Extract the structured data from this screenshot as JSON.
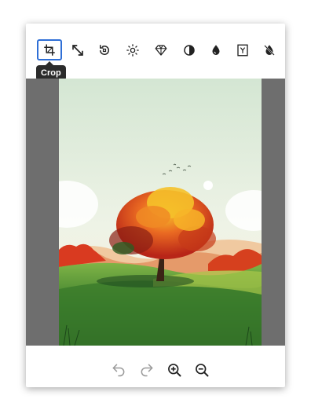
{
  "toolbar": {
    "tools": [
      {
        "name": "crop",
        "icon": "crop-icon",
        "active": true
      },
      {
        "name": "resize",
        "icon": "resize-arrows-icon"
      },
      {
        "name": "rotate",
        "icon": "rotate-icon"
      },
      {
        "name": "brightness",
        "icon": "sun-icon"
      },
      {
        "name": "sharpen",
        "icon": "diamond-icon"
      },
      {
        "name": "contrast",
        "icon": "contrast-icon"
      },
      {
        "name": "saturation",
        "icon": "drop-icon"
      },
      {
        "name": "filter",
        "icon": "filter-frame-icon"
      },
      {
        "name": "no-filter",
        "icon": "drop-off-icon"
      }
    ],
    "tooltip": "Crop"
  },
  "canvas": {
    "image": "tree-landscape-illustration"
  },
  "footer": {
    "undo_icon": "undo-icon",
    "redo_icon": "redo-icon",
    "zoom_in_icon": "zoom-in-icon",
    "zoom_out_icon": "zoom-out-icon"
  },
  "colors": {
    "accent": "#2f6fd6",
    "tooltip_bg": "#2b2b2b",
    "canvas_bg": "#6e6e6e",
    "disabled": "#9a9a9a"
  }
}
